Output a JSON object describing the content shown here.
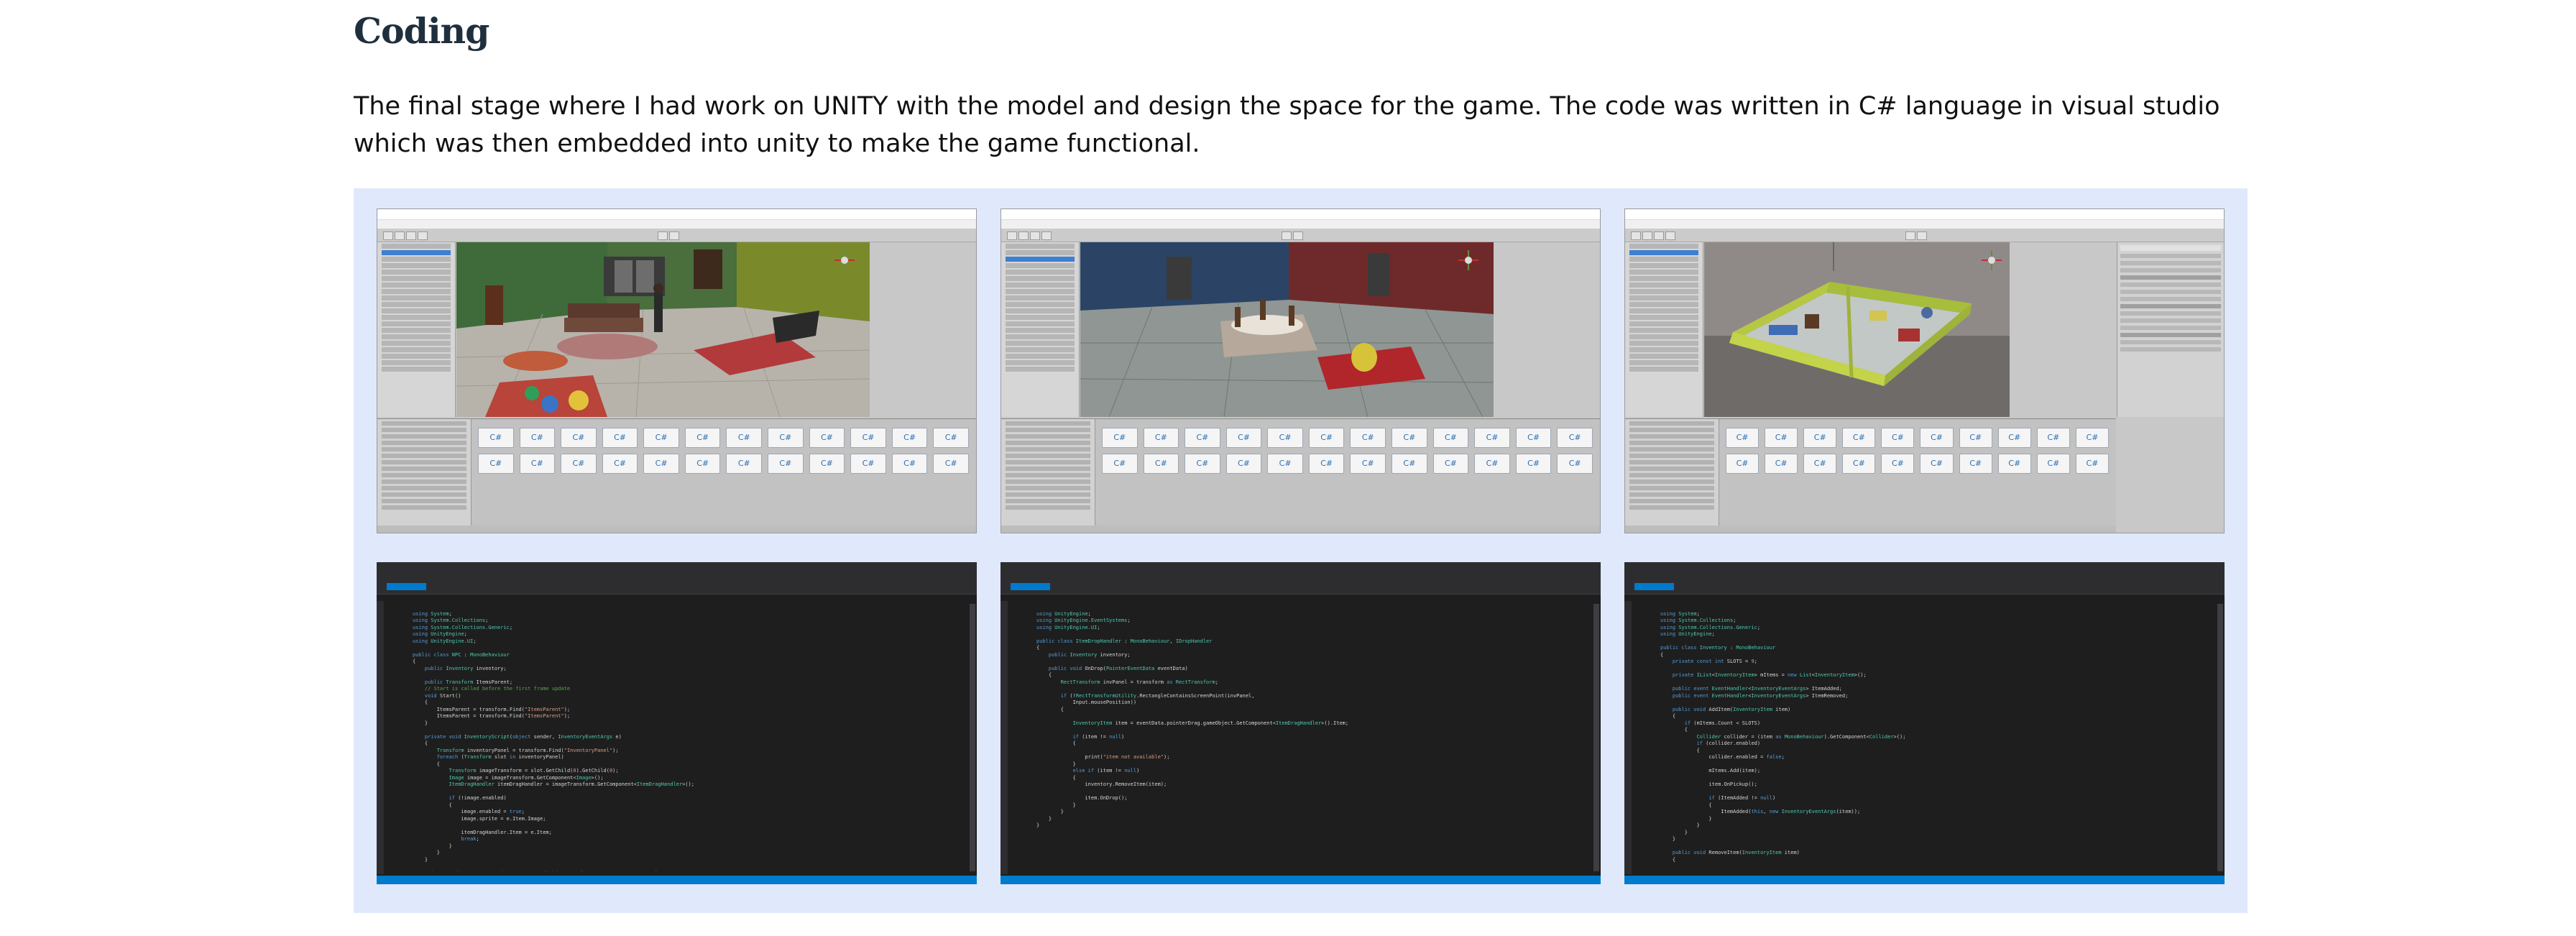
{
  "section": {
    "heading": "Coding",
    "paragraph": "The final stage where I had work on UNITY with the model and design the space for the game. The code was written in C# language in visual studio which was then embedded into unity to make the game functional."
  },
  "gallery": {
    "background": "#dfe9fb",
    "images": [
      {
        "kind": "unity-editor",
        "caption_in_picture": "C#"
      },
      {
        "kind": "unity-editor",
        "caption_in_picture": "C#"
      },
      {
        "kind": "unity-editor",
        "caption_in_picture": "C#"
      },
      {
        "kind": "visual-studio-code-editor"
      },
      {
        "kind": "visual-studio-code-editor"
      },
      {
        "kind": "visual-studio-code-editor"
      }
    ]
  },
  "colors": {
    "heading": "#1f2f3d",
    "unity_chrome": "#c8c8c8",
    "vs_background": "#1e1e1e",
    "vs_accent": "#007acc"
  }
}
